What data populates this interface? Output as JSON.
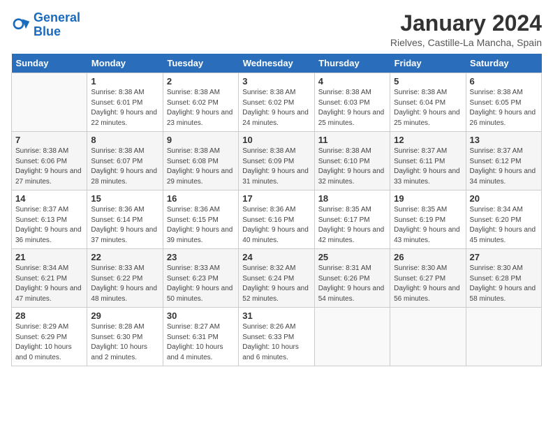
{
  "header": {
    "logo_line1": "General",
    "logo_line2": "Blue",
    "month_title": "January 2024",
    "location": "Rielves, Castille-La Mancha, Spain"
  },
  "weekdays": [
    "Sunday",
    "Monday",
    "Tuesday",
    "Wednesday",
    "Thursday",
    "Friday",
    "Saturday"
  ],
  "weeks": [
    [
      {
        "day": "",
        "empty": true
      },
      {
        "day": "1",
        "sunrise": "Sunrise: 8:38 AM",
        "sunset": "Sunset: 6:01 PM",
        "daylight": "Daylight: 9 hours and 22 minutes."
      },
      {
        "day": "2",
        "sunrise": "Sunrise: 8:38 AM",
        "sunset": "Sunset: 6:02 PM",
        "daylight": "Daylight: 9 hours and 23 minutes."
      },
      {
        "day": "3",
        "sunrise": "Sunrise: 8:38 AM",
        "sunset": "Sunset: 6:02 PM",
        "daylight": "Daylight: 9 hours and 24 minutes."
      },
      {
        "day": "4",
        "sunrise": "Sunrise: 8:38 AM",
        "sunset": "Sunset: 6:03 PM",
        "daylight": "Daylight: 9 hours and 25 minutes."
      },
      {
        "day": "5",
        "sunrise": "Sunrise: 8:38 AM",
        "sunset": "Sunset: 6:04 PM",
        "daylight": "Daylight: 9 hours and 25 minutes."
      },
      {
        "day": "6",
        "sunrise": "Sunrise: 8:38 AM",
        "sunset": "Sunset: 6:05 PM",
        "daylight": "Daylight: 9 hours and 26 minutes."
      }
    ],
    [
      {
        "day": "7",
        "sunrise": "Sunrise: 8:38 AM",
        "sunset": "Sunset: 6:06 PM",
        "daylight": "Daylight: 9 hours and 27 minutes."
      },
      {
        "day": "8",
        "sunrise": "Sunrise: 8:38 AM",
        "sunset": "Sunset: 6:07 PM",
        "daylight": "Daylight: 9 hours and 28 minutes."
      },
      {
        "day": "9",
        "sunrise": "Sunrise: 8:38 AM",
        "sunset": "Sunset: 6:08 PM",
        "daylight": "Daylight: 9 hours and 29 minutes."
      },
      {
        "day": "10",
        "sunrise": "Sunrise: 8:38 AM",
        "sunset": "Sunset: 6:09 PM",
        "daylight": "Daylight: 9 hours and 31 minutes."
      },
      {
        "day": "11",
        "sunrise": "Sunrise: 8:38 AM",
        "sunset": "Sunset: 6:10 PM",
        "daylight": "Daylight: 9 hours and 32 minutes."
      },
      {
        "day": "12",
        "sunrise": "Sunrise: 8:37 AM",
        "sunset": "Sunset: 6:11 PM",
        "daylight": "Daylight: 9 hours and 33 minutes."
      },
      {
        "day": "13",
        "sunrise": "Sunrise: 8:37 AM",
        "sunset": "Sunset: 6:12 PM",
        "daylight": "Daylight: 9 hours and 34 minutes."
      }
    ],
    [
      {
        "day": "14",
        "sunrise": "Sunrise: 8:37 AM",
        "sunset": "Sunset: 6:13 PM",
        "daylight": "Daylight: 9 hours and 36 minutes."
      },
      {
        "day": "15",
        "sunrise": "Sunrise: 8:36 AM",
        "sunset": "Sunset: 6:14 PM",
        "daylight": "Daylight: 9 hours and 37 minutes."
      },
      {
        "day": "16",
        "sunrise": "Sunrise: 8:36 AM",
        "sunset": "Sunset: 6:15 PM",
        "daylight": "Daylight: 9 hours and 39 minutes."
      },
      {
        "day": "17",
        "sunrise": "Sunrise: 8:36 AM",
        "sunset": "Sunset: 6:16 PM",
        "daylight": "Daylight: 9 hours and 40 minutes."
      },
      {
        "day": "18",
        "sunrise": "Sunrise: 8:35 AM",
        "sunset": "Sunset: 6:17 PM",
        "daylight": "Daylight: 9 hours and 42 minutes."
      },
      {
        "day": "19",
        "sunrise": "Sunrise: 8:35 AM",
        "sunset": "Sunset: 6:19 PM",
        "daylight": "Daylight: 9 hours and 43 minutes."
      },
      {
        "day": "20",
        "sunrise": "Sunrise: 8:34 AM",
        "sunset": "Sunset: 6:20 PM",
        "daylight": "Daylight: 9 hours and 45 minutes."
      }
    ],
    [
      {
        "day": "21",
        "sunrise": "Sunrise: 8:34 AM",
        "sunset": "Sunset: 6:21 PM",
        "daylight": "Daylight: 9 hours and 47 minutes."
      },
      {
        "day": "22",
        "sunrise": "Sunrise: 8:33 AM",
        "sunset": "Sunset: 6:22 PM",
        "daylight": "Daylight: 9 hours and 48 minutes."
      },
      {
        "day": "23",
        "sunrise": "Sunrise: 8:33 AM",
        "sunset": "Sunset: 6:23 PM",
        "daylight": "Daylight: 9 hours and 50 minutes."
      },
      {
        "day": "24",
        "sunrise": "Sunrise: 8:32 AM",
        "sunset": "Sunset: 6:24 PM",
        "daylight": "Daylight: 9 hours and 52 minutes."
      },
      {
        "day": "25",
        "sunrise": "Sunrise: 8:31 AM",
        "sunset": "Sunset: 6:26 PM",
        "daylight": "Daylight: 9 hours and 54 minutes."
      },
      {
        "day": "26",
        "sunrise": "Sunrise: 8:30 AM",
        "sunset": "Sunset: 6:27 PM",
        "daylight": "Daylight: 9 hours and 56 minutes."
      },
      {
        "day": "27",
        "sunrise": "Sunrise: 8:30 AM",
        "sunset": "Sunset: 6:28 PM",
        "daylight": "Daylight: 9 hours and 58 minutes."
      }
    ],
    [
      {
        "day": "28",
        "sunrise": "Sunrise: 8:29 AM",
        "sunset": "Sunset: 6:29 PM",
        "daylight": "Daylight: 10 hours and 0 minutes."
      },
      {
        "day": "29",
        "sunrise": "Sunrise: 8:28 AM",
        "sunset": "Sunset: 6:30 PM",
        "daylight": "Daylight: 10 hours and 2 minutes."
      },
      {
        "day": "30",
        "sunrise": "Sunrise: 8:27 AM",
        "sunset": "Sunset: 6:31 PM",
        "daylight": "Daylight: 10 hours and 4 minutes."
      },
      {
        "day": "31",
        "sunrise": "Sunrise: 8:26 AM",
        "sunset": "Sunset: 6:33 PM",
        "daylight": "Daylight: 10 hours and 6 minutes."
      },
      {
        "day": "",
        "empty": true
      },
      {
        "day": "",
        "empty": true
      },
      {
        "day": "",
        "empty": true
      }
    ]
  ]
}
